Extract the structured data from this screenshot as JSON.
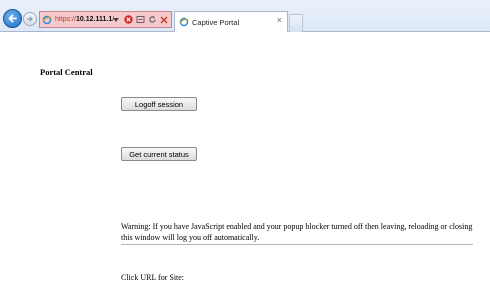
{
  "browser": {
    "address": {
      "scheme": "https://",
      "host": "10.12.111.1",
      "path": "/"
    },
    "tab": {
      "title": "Captive Portal",
      "close_glyph": "×"
    },
    "icons": {
      "back": "back-arrow-icon",
      "forward": "forward-arrow-icon",
      "favicon": "ie-page-icon",
      "search_dropdown": "chevron-down-icon",
      "cert_error": "certificate-error-icon",
      "compatibility": "compatibility-view-icon",
      "refresh": "refresh-icon",
      "stop": "stop-icon"
    },
    "colors": {
      "address_error_bg": "#f6c9cd",
      "back_button": "#1d6fc4"
    }
  },
  "page": {
    "title": "Portal Central",
    "logoff_label": "Logoff session",
    "status_label": "Get current status",
    "warning": "Warning: If you have JavaScript enabled and your popup blocker turned off then leaving, reloading or closing this window will log you off automatically.",
    "url_label": "Click URL for Site:"
  }
}
